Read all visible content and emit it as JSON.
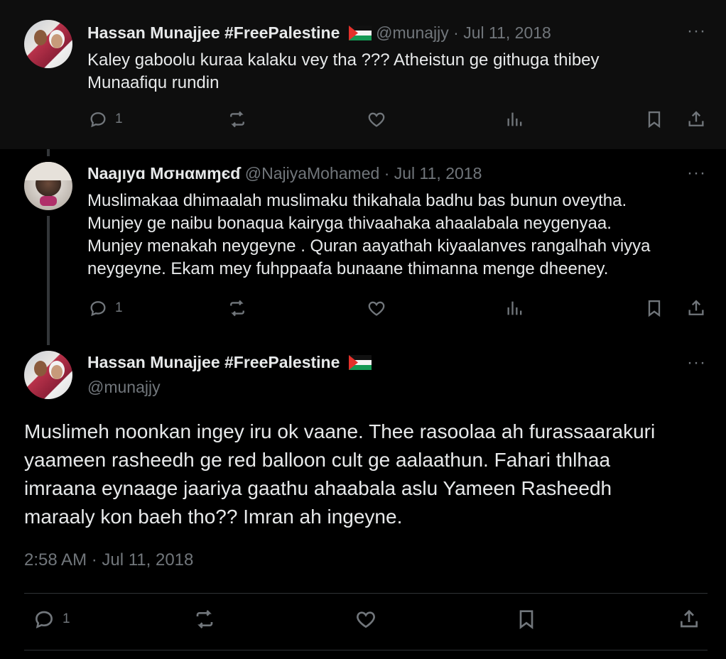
{
  "tweets": [
    {
      "name": "Hassan Munajjee #FreePalestine",
      "handle": "@munajjy",
      "date": "Jul 11, 2018",
      "sep": "·",
      "text_lines": [
        "Kaley gaboolu kuraa kalaku vey tha ??? Atheistun ge githuga thibey",
        "Munaafiqu rundin"
      ],
      "replies": "1"
    },
    {
      "name": "Naaȷıyɑ Mσнαмɱєɗ",
      "handle": "@NajiyaMohamed",
      "date": "Jul 11, 2018",
      "sep": "·",
      "text_lines": [
        "Muslimakaa dhimaalah muslimaku thikahala badhu bas bunun oveytha.",
        "Munjey ge naibu bonaqua kairyga thivaahaka ahaalabala neygenyaa.",
        "Munjey menakah neygeyne . Quran aayathah kiyaalanves rangalhah viyya",
        "neygeyne. Ekam mey fuhppaafa bunaane thimanna menge dheeney."
      ],
      "replies": "1"
    }
  ],
  "main_tweet": {
    "name": "Hassan Munajjee #FreePalestine",
    "handle": "@munajjy",
    "text_lines": [
      "Muslimeh noonkan ingey iru ok vaane. Thee rasoolaa ah furassaarakuri",
      "yaameen rasheedh ge red balloon cult ge aalaathun. Fahari thlhaa",
      "imraana eynaage jaariya gaathu ahaabala aslu Yameen Rasheedh",
      "maraaly kon baeh tho?? Imran ah ingeyne."
    ],
    "timestamp": "2:58 AM · Jul 11, 2018",
    "replies": "1"
  },
  "colors": {
    "background": "#000000",
    "text": "#e7e9ea",
    "muted": "#71767b",
    "divider": "#2f3336"
  },
  "icons": [
    "reply-icon",
    "retweet-icon",
    "like-icon",
    "views-icon",
    "bookmark-icon",
    "share-icon",
    "more-icon",
    "palestine-flag-icon"
  ]
}
